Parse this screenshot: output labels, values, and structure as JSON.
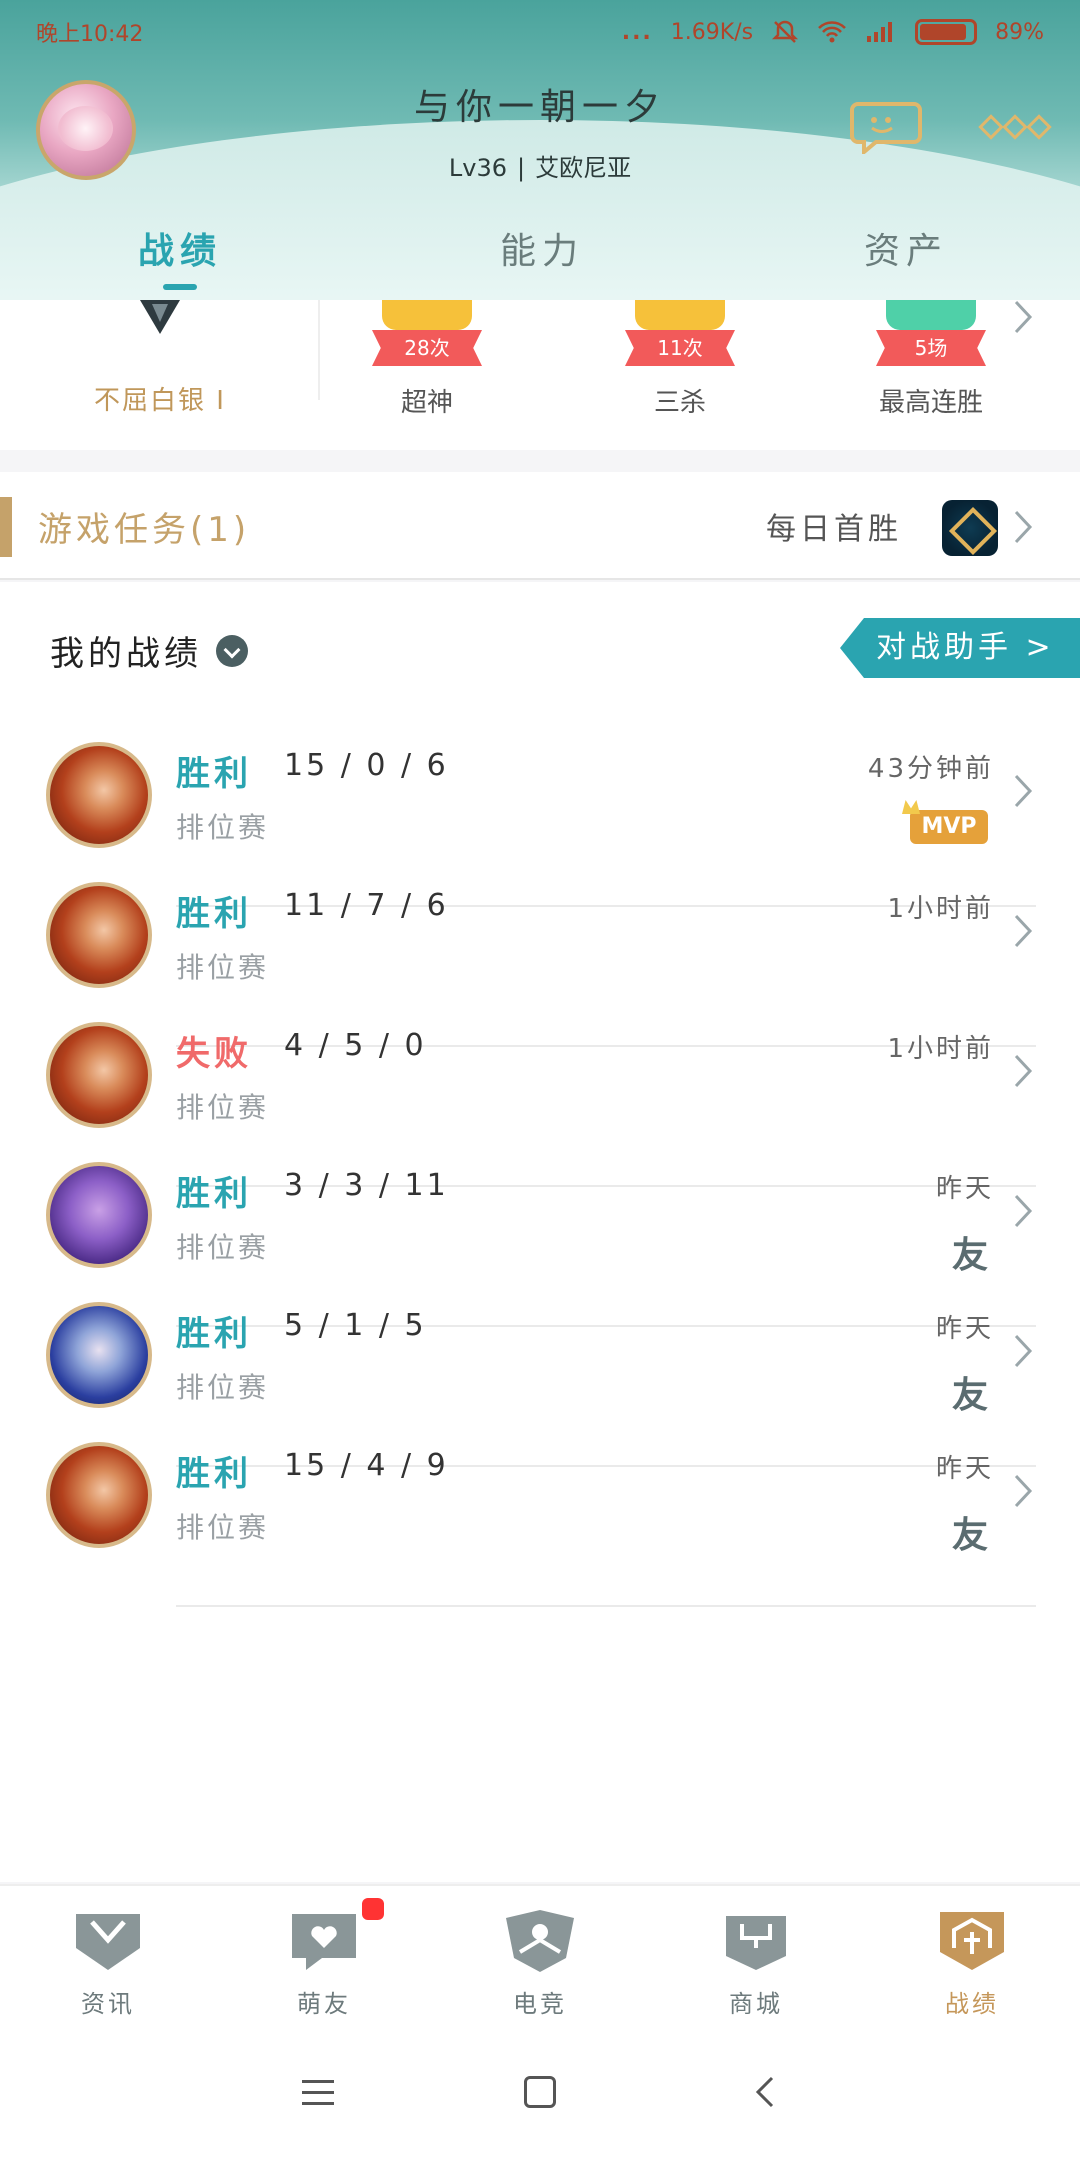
{
  "status_bar": {
    "time": "晚上10:42",
    "dots": "...",
    "speed": "1.69K/s",
    "battery": "89%"
  },
  "profile": {
    "name": "与你一朝一夕",
    "level": "Lv36",
    "separator": "|",
    "server": "艾欧尼亚"
  },
  "tabs": [
    {
      "label": "战绩"
    },
    {
      "label": "能力"
    },
    {
      "label": "资产"
    }
  ],
  "achievements": {
    "rank_label": "不屈白银 I",
    "badges": [
      {
        "count": "28次",
        "label": "超神",
        "color": "#f6c13a"
      },
      {
        "count": "11次",
        "label": "三杀",
        "color": "#f6c13a"
      },
      {
        "count": "5场",
        "label": "最高连胜",
        "color": "#4fd0a8"
      }
    ]
  },
  "tasks": {
    "title": "游戏任务(1)",
    "daily": "每日首胜"
  },
  "records": {
    "header": "我的战绩",
    "assistant_button": "对战助手 >",
    "items": [
      {
        "result": "胜利",
        "outcome": "win",
        "kda": "15 / 0 / 6",
        "mode": "排位赛",
        "time": "43分钟前",
        "badge": "MVP",
        "avatar": "red"
      },
      {
        "result": "胜利",
        "outcome": "win",
        "kda": "11 / 7 / 6",
        "mode": "排位赛",
        "time": "1小时前",
        "badge": "",
        "avatar": "red"
      },
      {
        "result": "失败",
        "outcome": "lose",
        "kda": "4 / 5 / 0",
        "mode": "排位赛",
        "time": "1小时前",
        "badge": "",
        "avatar": "red"
      },
      {
        "result": "胜利",
        "outcome": "win",
        "kda": "3 / 3 / 11",
        "mode": "排位赛",
        "time": "昨天",
        "badge": "友",
        "avatar": "purple"
      },
      {
        "result": "胜利",
        "outcome": "win",
        "kda": "5 / 1 / 5",
        "mode": "排位赛",
        "time": "昨天",
        "badge": "友",
        "avatar": "blue"
      },
      {
        "result": "胜利",
        "outcome": "win",
        "kda": "15 / 4 / 9",
        "mode": "排位赛",
        "time": "昨天",
        "badge": "友",
        "avatar": "red"
      }
    ]
  },
  "bottom_nav": [
    {
      "label": "资讯",
      "icon": "book-shield-icon"
    },
    {
      "label": "萌友",
      "icon": "chat-heart-icon"
    },
    {
      "label": "电竞",
      "icon": "esports-shield-icon"
    },
    {
      "label": "商城",
      "icon": "shop-bag-icon"
    },
    {
      "label": "战绩",
      "icon": "castle-shield-icon"
    }
  ],
  "colors": {
    "accent": "#2aa4b0",
    "gold": "#c5975a",
    "lose": "#f06a6a",
    "ribbon": "#f25a5a",
    "notification": "#ff3333"
  }
}
